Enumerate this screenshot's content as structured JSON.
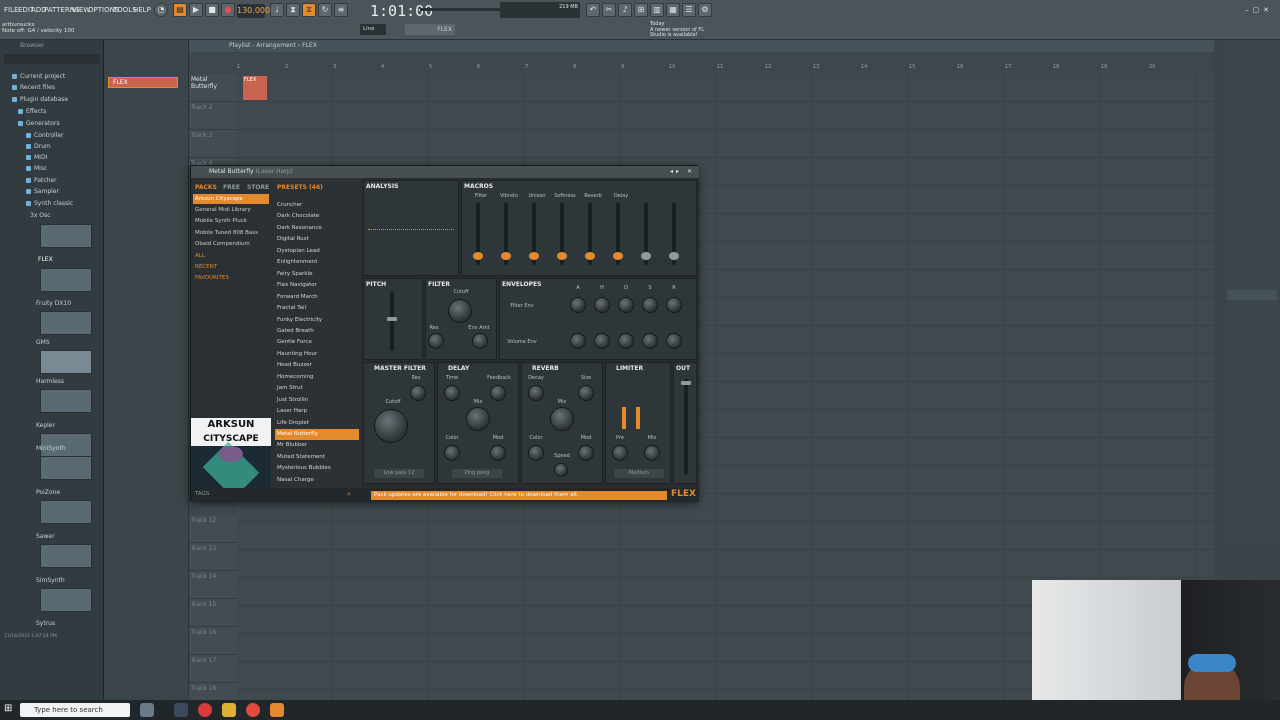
{
  "menu": [
    "FILE",
    "EDIT",
    "ADD",
    "PATTERNS",
    "VIEW",
    "OPTIONS",
    "TOOLS",
    "HELP"
  ],
  "transport": {
    "time": "1:01:00",
    "tempo": "130.000",
    "cpu": "219 MB"
  },
  "hint": {
    "user": "arthursucks",
    "note": "Note off: G4 / velocity 100"
  },
  "news": {
    "line1": "Today",
    "line2": "A newer version of FL Studio is available!"
  },
  "toolbar": {
    "snap": "Line",
    "pattern_name": "FLEX"
  },
  "browser": {
    "title": "Browser",
    "items": [
      "Current project",
      "Recent files",
      "Plugin database",
      "Effects",
      "Generators",
      "Controller",
      "Drum",
      "MIDI",
      "Misc",
      "Patcher",
      "Sampler",
      "Synth classic",
      "3x Osc",
      "FLEX",
      "Fruity DX10",
      "GMS",
      "Harmless",
      "Kepler",
      "MiniSynth",
      "PoiZone",
      "Sawer",
      "SimSynth",
      "Sytrus"
    ],
    "footer": "11/14/2022 1:07:24 PM"
  },
  "channel": {
    "name": "FLEX"
  },
  "playlist": {
    "title": "Playlist - Arrangement",
    "pattern": "FLEX",
    "tracks": [
      "Metal Butterfly",
      "Track 2",
      "Track 3",
      "Track 4",
      "Track 12",
      "Track 13",
      "Track 14",
      "Track 15",
      "Track 16",
      "Track 17",
      "Track 18"
    ],
    "bar_numbers": [
      "1",
      "2",
      "3",
      "4",
      "5",
      "6",
      "7",
      "8",
      "9",
      "10",
      "11",
      "12",
      "13",
      "14",
      "15",
      "16",
      "17",
      "18",
      "19",
      "20"
    ]
  },
  "flex": {
    "title": "Metal Butterfly",
    "subtitle": "(Laser Harp)",
    "tabs": {
      "packs": "PACKS",
      "free": "FREE",
      "store": "STORE",
      "presets": "PRESETS (46)"
    },
    "packs": [
      "Arksun Cityscape",
      "General Midi Library",
      "Mobile Synth Pluck",
      "Mobile Tuned 808 Bass",
      "Obaid Compendium",
      "ALL",
      "RECENT",
      "FAVOURITES"
    ],
    "art": {
      "line1": "ARKSUN",
      "line2": "CITYSCAPE"
    },
    "presets": [
      "Cruncher",
      "Dark Chocolate",
      "Dark Resonance",
      "Digital Rust",
      "Dystopian Lead",
      "Enlightenment",
      "Fairy Sparkle",
      "Flex Navigator",
      "Forward March",
      "Fractal Tail",
      "Funky Electricity",
      "Gated Breath",
      "Gentle Force",
      "Haunting Hour",
      "Head Buzzer",
      "Homecoming",
      "Jam Strut",
      "Just Strollin",
      "Laser Harp",
      "Life Droplet",
      "Metal Butterfly",
      "Mr Blubber",
      "Muted Statement",
      "Mysterious Bubbles",
      "Nasal Charge"
    ],
    "selected_preset": "Metal Butterfly",
    "sections": {
      "analysis": "ANALYSIS",
      "macros": "MACROS",
      "pitch": "PITCH",
      "filter": "FILTER",
      "envelopes": "ENVELOPES",
      "master_filter": "MASTER FILTER",
      "delay": "DELAY",
      "reverb": "REVERB",
      "limiter": "LIMITER",
      "out": "OUT"
    },
    "macros": [
      "Filter",
      "Vibrato",
      "Unison",
      "Softness",
      "Reverb",
      "Delay",
      "",
      ""
    ],
    "macro_levels": [
      0.1,
      0.1,
      0.1,
      0.1,
      0.1,
      0.1,
      0.1,
      0.1
    ],
    "filter_knobs": [
      "Cutoff",
      "Res",
      "Env Amt"
    ],
    "env_rows": [
      "Filter Env",
      "Volume Env"
    ],
    "env_cols": [
      "A",
      "H",
      "D",
      "S",
      "R"
    ],
    "master_knobs": [
      "Res",
      "Cutoff"
    ],
    "delay_knobs": [
      "Time",
      "Feedback",
      "Mix",
      "Color",
      "Mod"
    ],
    "reverb_knobs": [
      "Decay",
      "Size",
      "Mix",
      "Color",
      "Mod",
      "Speed"
    ],
    "limiter_knobs": [
      "Pre",
      "Mix"
    ],
    "master_mode": "Low pass 12",
    "delay_mode": "Ping pong",
    "limiter_mode": "Medium",
    "banner": "Pack updates are available for download! Click here to download them all.",
    "logo": "FLEX",
    "footer_tags": "TAGS"
  },
  "taskbar": {
    "search_placeholder": "Type here to search"
  },
  "colors": {
    "accent": "#e58a2c",
    "bg": "#3a4449"
  }
}
